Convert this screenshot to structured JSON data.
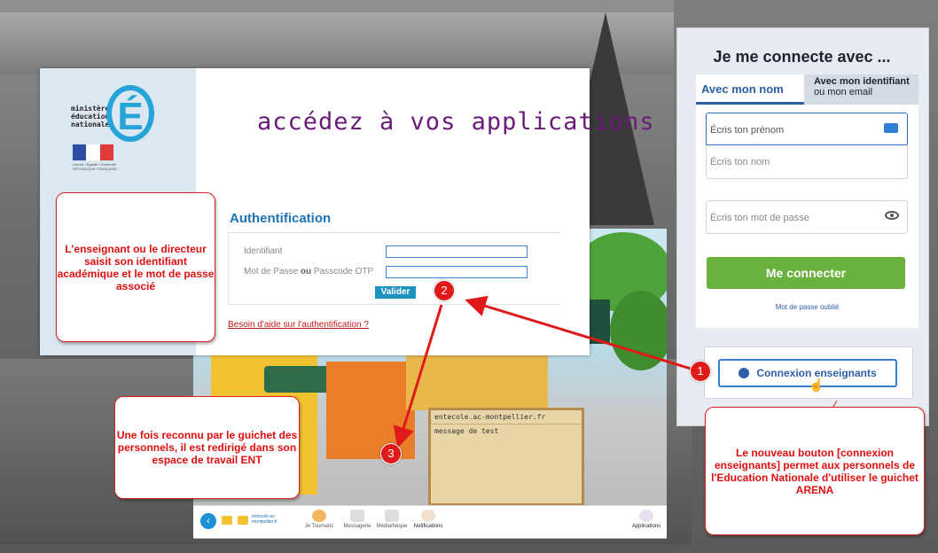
{
  "auth_window": {
    "logo_text": "ministère\néducation\nnationale",
    "logo_letter": "É",
    "flag_caption": "Liberté • Égalité • Fraternité RÉPUBLIQUE FRANÇAISE",
    "title": "accédez à vos applications",
    "heading": "Authentification",
    "identifiant_label": "Identifiant",
    "password_label_prefix": "Mot de Passe ",
    "password_label_or": "ou",
    "password_label_suffix": " Passcode OTP",
    "identifiant_value": "",
    "password_value": "",
    "submit_label": "Valider",
    "help_link": "Besoin d'aide sur l'authentification ?"
  },
  "ent": {
    "board_line1": "entecole.ac-montpellier.fr",
    "board_line2": "message de test",
    "site_label": "entecole.ac-montpellier.fr",
    "bar_items": [
      "Je Tourneriz",
      "Messagerie",
      "Médiathèque",
      "Notifications"
    ],
    "apps_label": "Applications",
    "back_icon": "chevron-left-icon"
  },
  "login_panel": {
    "title": "Je me connecte avec ...",
    "tab_active": "Avec mon nom",
    "tab2_line1": "Avec mon identifiant",
    "tab2_line2": "ou mon email",
    "first_name_placeholder": "Écris ton prénom",
    "last_name_placeholder": "Écris ton nom",
    "password_placeholder": "Écris ton mot de passe",
    "connect_button": "Me connecter",
    "forgot_link": "Mot de passe oublié",
    "teacher_button": "Connexion enseignants"
  },
  "callouts": {
    "c1": "L'enseignant ou le directeur saisit son identifiant académique et le mot de passe associé",
    "c2": "Une fois reconnu par le guichet des personnels, il est redirigé dans son espace de travail ENT",
    "c3": "Le nouveau bouton [connexion enseignants] permet aux personnels de l'Education Nationale d'utiliser le guichet ARENA"
  },
  "badges": {
    "b1": "1",
    "b2": "2",
    "b3": "3"
  },
  "colors": {
    "arrow": "#e01919",
    "accent_blue": "#2d5ea8",
    "green": "#6bb13d",
    "title_purple": "#6a1b7a"
  }
}
